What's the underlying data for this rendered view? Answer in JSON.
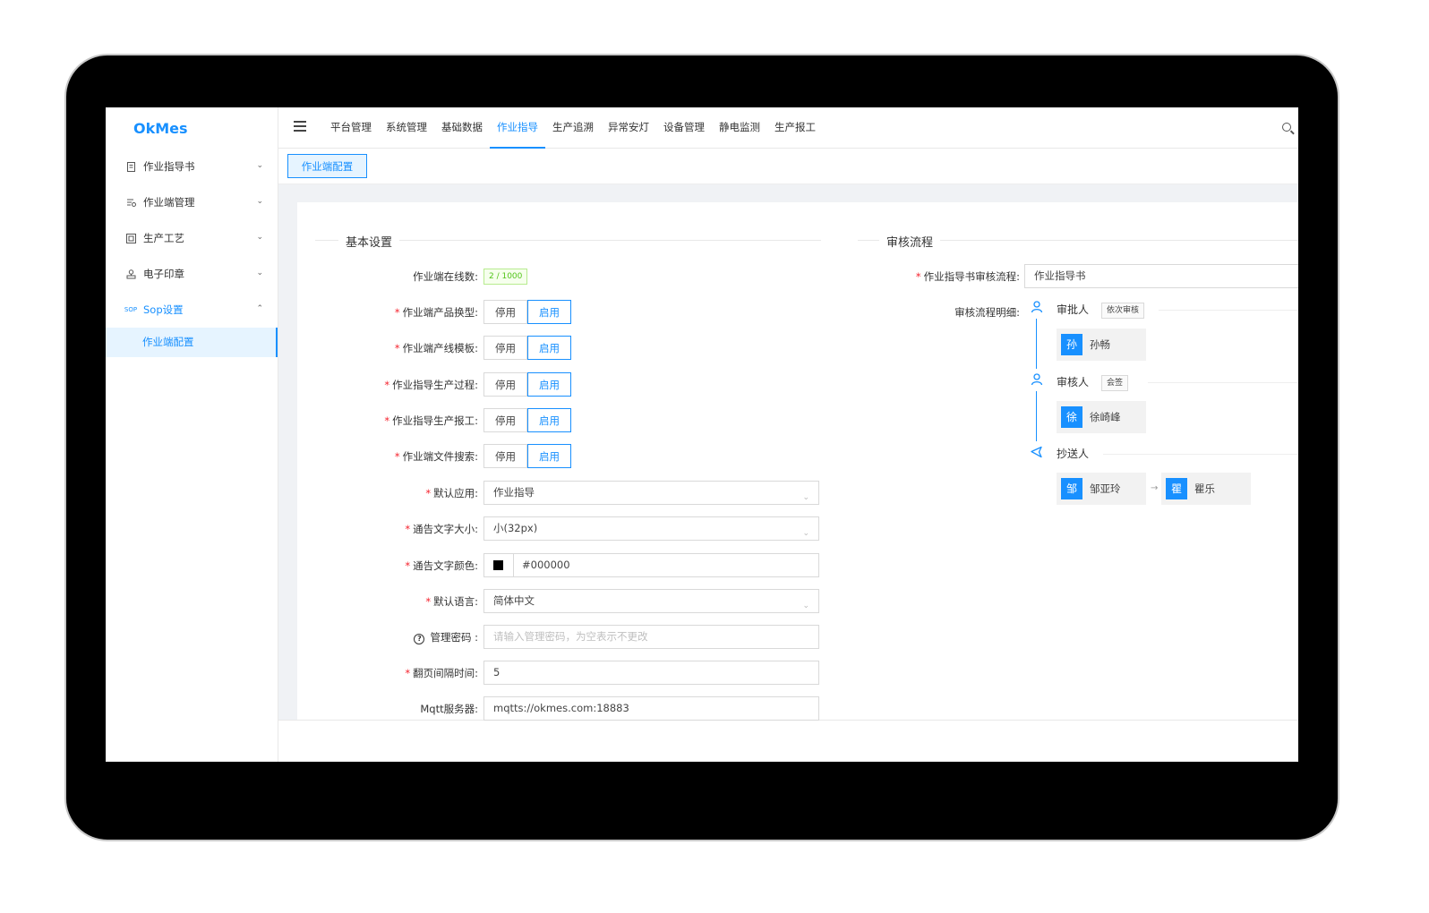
{
  "app": {
    "logo": "OkMes"
  },
  "sidebar": {
    "items": [
      {
        "label": "作业指导书",
        "icon": "document-icon"
      },
      {
        "label": "作业端管理",
        "icon": "terminal-icon"
      },
      {
        "label": "生产工艺",
        "icon": "process-icon"
      },
      {
        "label": "电子印章",
        "icon": "stamp-icon"
      },
      {
        "label": "Sop设置",
        "icon": "sop-icon",
        "icon_text": "SOP"
      }
    ],
    "sub_item": "作业端配置"
  },
  "topnav": {
    "items": [
      "平台管理",
      "系统管理",
      "基础数据",
      "作业指导",
      "生产追溯",
      "异常安灯",
      "设备管理",
      "静电监测",
      "生产报工"
    ],
    "active": "作业指导"
  },
  "tab": {
    "label": "作业端配置"
  },
  "basic": {
    "title": "基本设置",
    "online_label": "作业端在线数:",
    "online_value": "2 / 1000",
    "toggle_off": "停用",
    "toggle_on": "启用",
    "toggles": [
      {
        "label": "作业端产品换型:",
        "required": "*"
      },
      {
        "label": "作业端产线模板:",
        "required": "*"
      },
      {
        "label": "作业指导生产过程:",
        "required": "*"
      },
      {
        "label": "作业指导生产报工:",
        "required": "*"
      },
      {
        "label": "作业端文件搜索:",
        "required": "*"
      }
    ],
    "default_app": {
      "label": "默认应用:",
      "required": "*",
      "value": "作业指导"
    },
    "font_size": {
      "label": "通告文字大小:",
      "required": "*",
      "value": "小(32px)"
    },
    "font_color": {
      "label": "通告文字颜色:",
      "required": "*",
      "value": "#000000"
    },
    "language": {
      "label": "默认语言:",
      "required": "*",
      "value": "简体中文"
    },
    "password": {
      "label": "管理密码 :",
      "placeholder": "请输入管理密码，为空表示不更改"
    },
    "interval": {
      "label": "翻页间隔时间:",
      "required": "*",
      "value": "5"
    },
    "mqtt": {
      "label": "Mqtt服务器:",
      "value": "mqtts://okmes.com:18883"
    }
  },
  "review": {
    "title": "审核流程",
    "flow_label": "作业指导书审核流程:",
    "required": "*",
    "flow_value": "作业指导书",
    "detail_label": "审核流程明细:",
    "steps": [
      {
        "role": "审批人",
        "tag": "依次审核"
      },
      {
        "role": "审核人",
        "tag": "会签"
      },
      {
        "role": "抄送人"
      }
    ],
    "approver": {
      "avatar": "孙",
      "name": "孙畅"
    },
    "reviewer": {
      "avatar": "徐",
      "name": "徐崎峰"
    },
    "cc": [
      {
        "avatar": "邹",
        "name": "邹亚玲"
      },
      {
        "avatar": "瞿",
        "name": "瞿乐"
      }
    ]
  },
  "colors": {
    "accent": "#1890ff",
    "required": "#f5222d",
    "success": "#52c41a"
  }
}
